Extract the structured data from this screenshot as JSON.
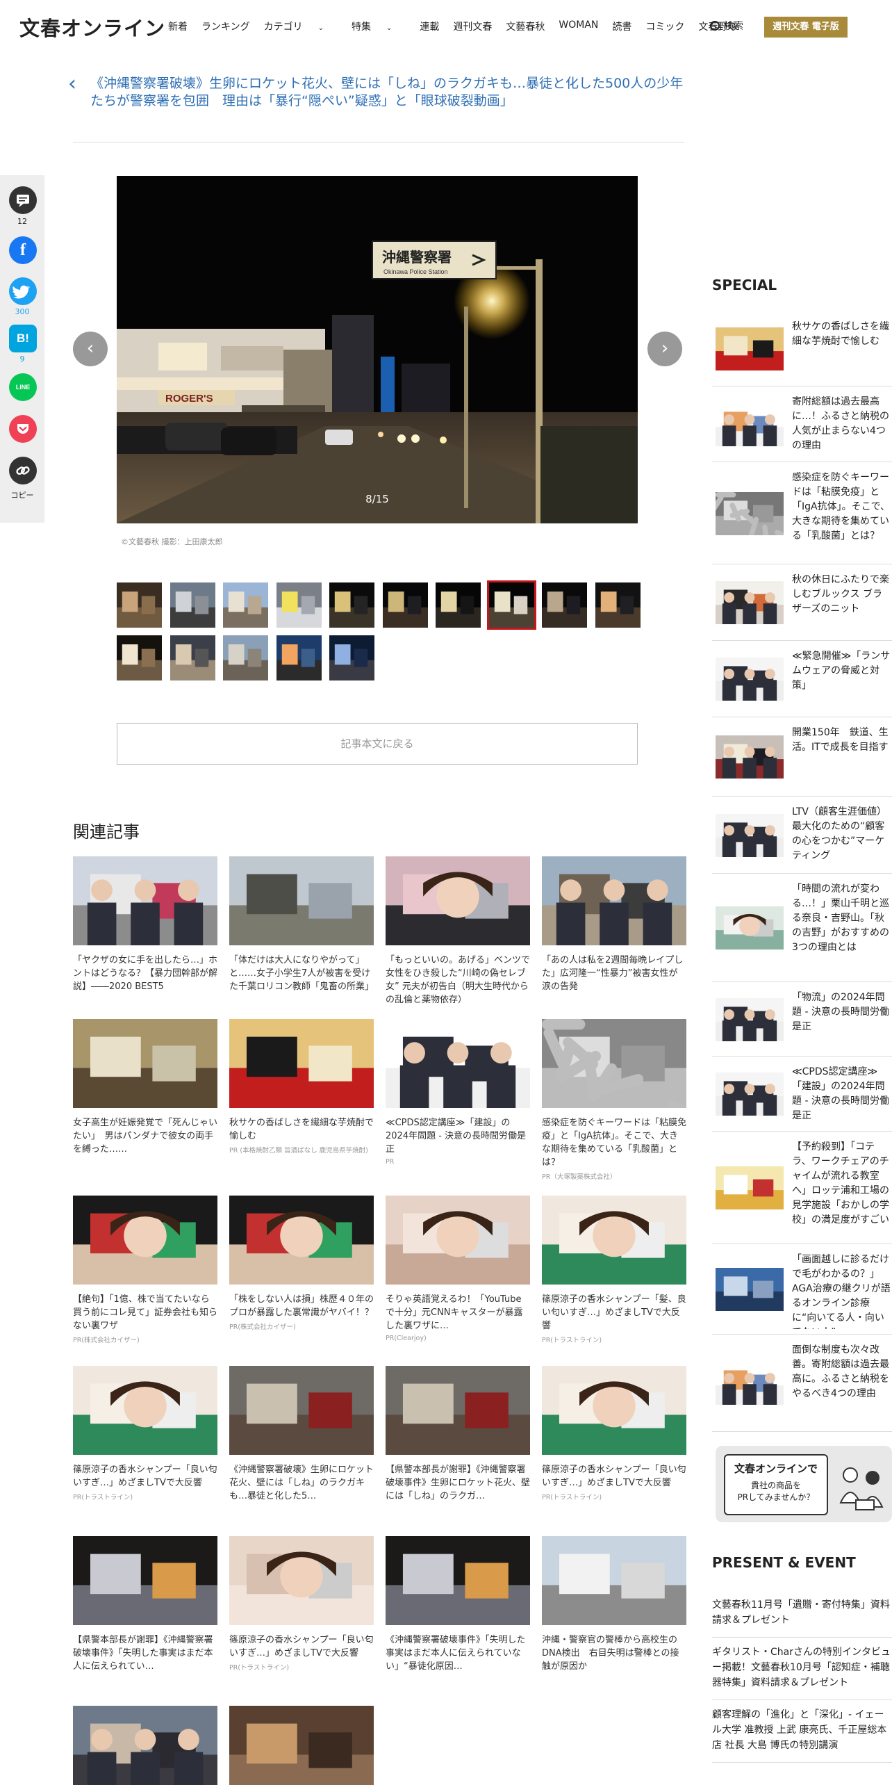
{
  "site": {
    "logo": "文春オンライン"
  },
  "nav": {
    "items": [
      "新着",
      "ランキング",
      "カテゴリ",
      "特集",
      "連載",
      "週刊文春",
      "文藝春秋",
      "WOMAN",
      "読書",
      "コミック",
      "文春野球"
    ],
    "search_label": "検索",
    "ebook_label": "週刊文春 電子版"
  },
  "article": {
    "back_title": "《沖縄警察署破壊》生卵にロケット花火、壁には「しね」のラクガキも…暴徒と化した500人の少年たちが警察署を包囲　理由は「暴行“隠ぺい”疑惑」と「眼球破裂動画」"
  },
  "share": {
    "comment_count": "12",
    "twitter_count": "300",
    "hatena_count": "9",
    "copy_label": "コピー",
    "hatena_label": "B!",
    "line_label": "LINE"
  },
  "gallery": {
    "counter": "8/15",
    "credit": "©文藝春秋 撮影：上田康太郎",
    "back_button": "記事本文に戻る",
    "active_index": 7,
    "sign_text": "沖縄警察署",
    "sign_sub": "Okinawa Police Station",
    "shop_text": "ROGER'S"
  },
  "related": {
    "heading": "関連記事",
    "items": [
      {
        "caption": "「ヤクザの女に手を出したら…」ホントはどうなる？【暴力団幹部が解説】――2020 BEST5",
        "pr": ""
      },
      {
        "caption": "「体だけは大人になりやがって」と……女子小学生7人が被害を受けた千葉ロリコン教師「鬼畜の所業」",
        "pr": ""
      },
      {
        "caption": "「もっといいの。あげる」ベンツで女性をひき殺した“川崎の偽セレブ女” 元夫が初告白（明大生時代からの乱倫と薬物依存）",
        "pr": ""
      },
      {
        "caption": "「あの人は私を2週間毎晩レイプした」広河隆一“性暴力”被害女性が涙の告発",
        "pr": ""
      },
      {
        "caption": "女子高生が妊娠発覚で「死んじゃいたい」　男はパンダナで彼女の両手を縛った……",
        "pr": ""
      },
      {
        "caption": "秋サケの香ばしさを繊細な芋焼酎で愉しむ",
        "pr": "PR (本格焼酎乙類 旨酒ばなし 鹿児島県芋焼酎)"
      },
      {
        "caption": "≪CPDS認定講座≫「建設」の2024年問題 - 決意の長時間労働是正",
        "pr": "PR"
      },
      {
        "caption": "感染症を防ぐキーワードは「粘膜免疫」と「IgA抗体」。そこで、大きな期待を集めている「乳酸菌」とは？",
        "pr": "PR（大塚製薬株式会社）"
      },
      {
        "caption": "【絶句】「1億、株で当てたいなら買う前にコレ見て」証券会社も知らない裏ワザ",
        "pr": "PR(株式会社カイザー)"
      },
      {
        "caption": "「株をしない人は損」株歴４０年のプロが暴露した裏常識がヤバイ！？",
        "pr": "PR(株式会社カイザー)"
      },
      {
        "caption": "そりゃ英語覚えるわ！「YouTubeで十分」元CNNキャスターが暴露した裏ワザに…",
        "pr": "PR(Clearjoy)"
      },
      {
        "caption": "篠原涼子の香水シャンプー「髪、良い匂いすぎ…」めざましTVで大反響",
        "pr": "PR(トラストライン)"
      },
      {
        "caption": "篠原涼子の香水シャンプー「良い匂いすぎ…」めざましTVで大反響",
        "pr": "PR(トラストライン)"
      },
      {
        "caption": "《沖縄警察署破壊》生卵にロケット花火、壁には「しね」のラクガキも…暴徒と化した5…",
        "pr": ""
      },
      {
        "caption": "【県警本部長が謝罪】《沖縄警察署破壊事件》生卵にロケット花火、壁には「しね」のラクガ…",
        "pr": ""
      },
      {
        "caption": "篠原涼子の香水シャンプー「良い匂いすぎ…」めざましTVで大反響",
        "pr": "PR(トラストライン)"
      },
      {
        "caption": "【県警本部長が謝罪】《沖縄警察署破壊事件》「失明した事実はまだ本人に伝えられてい…",
        "pr": ""
      },
      {
        "caption": "篠原涼子の香水シャンプー「良い匂いすぎ…」めざましTVで大反響",
        "pr": "PR(トラストライン)"
      },
      {
        "caption": "《沖縄警察署破壊事件》「失明した事実はまだ本人に伝えられていない」“暴徒化原因…",
        "pr": ""
      },
      {
        "caption": "沖縄・警察官の警棒から高校生のDNA検出　右目失明は警棒との接触が原因か",
        "pr": ""
      },
      {
        "caption": "",
        "pr": ""
      },
      {
        "caption": "",
        "pr": ""
      }
    ]
  },
  "special": {
    "heading": "SPECIAL",
    "items": [
      "秋サケの香ばしさを繊細な芋焼酎で愉しむ",
      "寄附総額は過去最高に…！ふるさと納税の人気が止まらない4つの理由",
      "感染症を防ぐキーワードは「粘膜免疫」と「IgA抗体」。そこで、大きな期待を集めている「乳酸菌」とは？",
      "秋の休日にふたりで楽しむブルックス ブラザーズのニット",
      "≪緊急開催≫「ランサムウェアの脅威と対策」",
      "開業150年　鉄道、生活。ITで成長を目指す",
      "LTV（顧客生涯価値）最大化のための“顧客の心をつかむ”マーケティング",
      "「時間の流れが変わる…！」栗山千明と巡る奈良・吉野山。「秋の吉野」がおすすめの3つの理由とは",
      "「物流」の2024年問題 - 決意の長時間労働是正",
      "≪CPDS認定講座≫「建設」の2024年問題 - 決意の長時間労働是正",
      "【予約殺到】「コテラ、ワークチェアのチャイムが流れる教室へ」ロッテ浦和工場の見学施設「おかしの学校」の満足度がすごい",
      "「画面越しに診るだけで毛がわかるの？」AGA治療の継クリが語るオンライン診療に“向いてる人・向いてない人”",
      "面倒な制度も次々改善。寄附総額は過去最高に。ふるさと納税をやるべき4つの理由"
    ],
    "ad_line1": "文春オンラインで",
    "ad_line2": "貴社の商品を",
    "ad_line3": "PRしてみませんか？"
  },
  "present": {
    "heading": "PRESENT & EVENT",
    "items": [
      "文藝春秋11月号「遺贈・寄付特集」資料請求＆プレゼント",
      "ギタリスト・Charさんの特別インタビュー掲載！文藝春秋10月号「認知症・補聴器特集」資料請求＆プレゼント",
      "顧客理解の「進化」と「深化」- イェール大学 准教授 上武 康亮氏、千正屋総本店 社長 大島 博氏の特別講演"
    ]
  },
  "colors": {
    "link": "#2f6fb4",
    "ebook": "#a88a3a",
    "active_thumb": "#c4161c",
    "facebook": "#1877f2",
    "twitter": "#1da1f2",
    "hatena": "#00a4de",
    "line": "#06c755",
    "pocket": "#ef4056"
  }
}
